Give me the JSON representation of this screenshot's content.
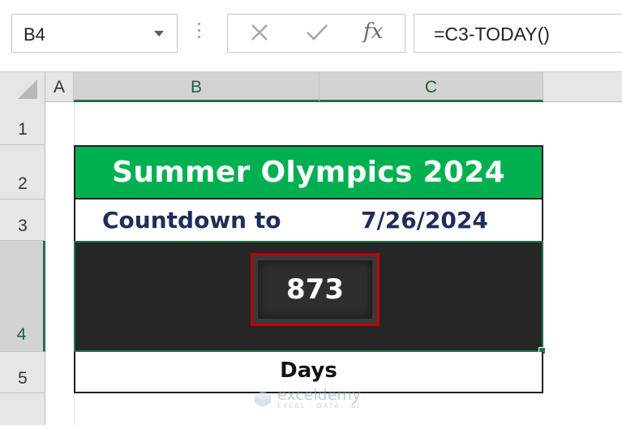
{
  "formula_bar": {
    "name_box": "B4",
    "formula": "=C3-TODAY()",
    "fx_label": "fx"
  },
  "columns": [
    "A",
    "B",
    "C"
  ],
  "rows": [
    "1",
    "2",
    "3",
    "4",
    "5"
  ],
  "selected_cell": {
    "column": "B",
    "row": "4"
  },
  "sheet": {
    "title": "Summer Olympics 2024",
    "countdown_label": "Countdown to",
    "countdown_date": "7/26/2024",
    "days_value": "873",
    "days_label": "Days"
  },
  "colors": {
    "title_fill": "#00b050",
    "value_fill": "#262626",
    "highlight_border": "#c00000",
    "selection_green": "#217346",
    "label_text": "#1f2d5a"
  },
  "watermark": {
    "name": "exceldemy",
    "tagline": "EXCEL · DATA · BI"
  }
}
